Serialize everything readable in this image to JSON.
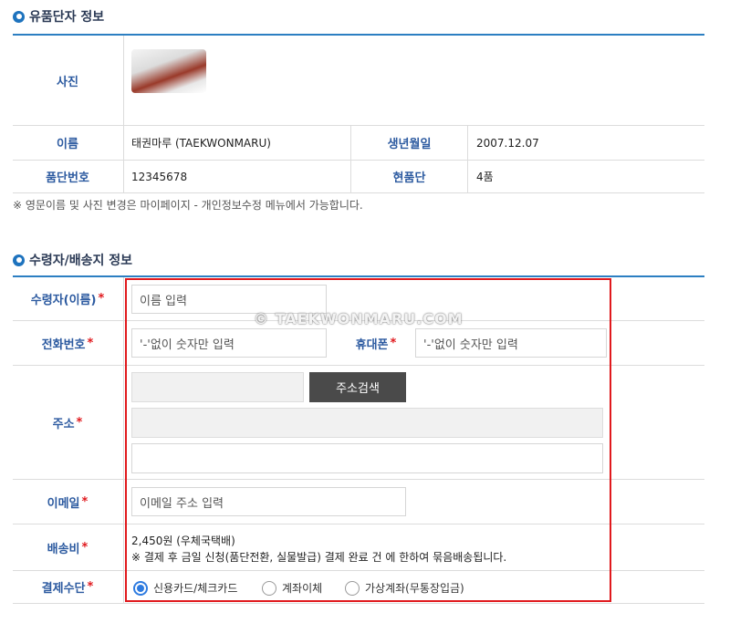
{
  "section1": {
    "title": "유품단자 정보",
    "labels": {
      "photo": "사진",
      "name": "이름",
      "birth": "생년월일",
      "number": "품단번호",
      "current": "현품단"
    },
    "values": {
      "name": "태권마루 (TAEKWONMARU)",
      "birth": "2007.12.07",
      "number": "12345678",
      "current": "4품"
    },
    "note": "※ 영문이름 및 사진 변경은 마이페이지 - 개인정보수정 메뉴에서 가능합니다."
  },
  "section2": {
    "title": "수령자/배송지 정보",
    "required_mark": "*",
    "labels": {
      "recipient": "수령자(이름)",
      "phone": "전화번호",
      "mobile": "휴대폰",
      "address": "주소",
      "email": "이메일",
      "shipping": "배송비",
      "payment": "결제수단"
    },
    "placeholders": {
      "recipient": "이름 입력",
      "phone": "'-'없이 숫자만 입력",
      "mobile": "'-'없이 숫자만 입력",
      "email": "이메일 주소 입력"
    },
    "address_button": "주소검색",
    "shipping_fee": "2,450원 (우체국택배)",
    "shipping_note": "※ 결제 후 금일 신청(품단전환, 실물발급) 결제 완료 건 에 한하여 묶음배송됩니다.",
    "payment_options": [
      "신용카드/체크카드",
      "계좌이체",
      "가상계좌(무통장입금)"
    ],
    "payment_selected": "신용카드/체크카드"
  },
  "watermark": "© TAEKWONMARU.COM"
}
